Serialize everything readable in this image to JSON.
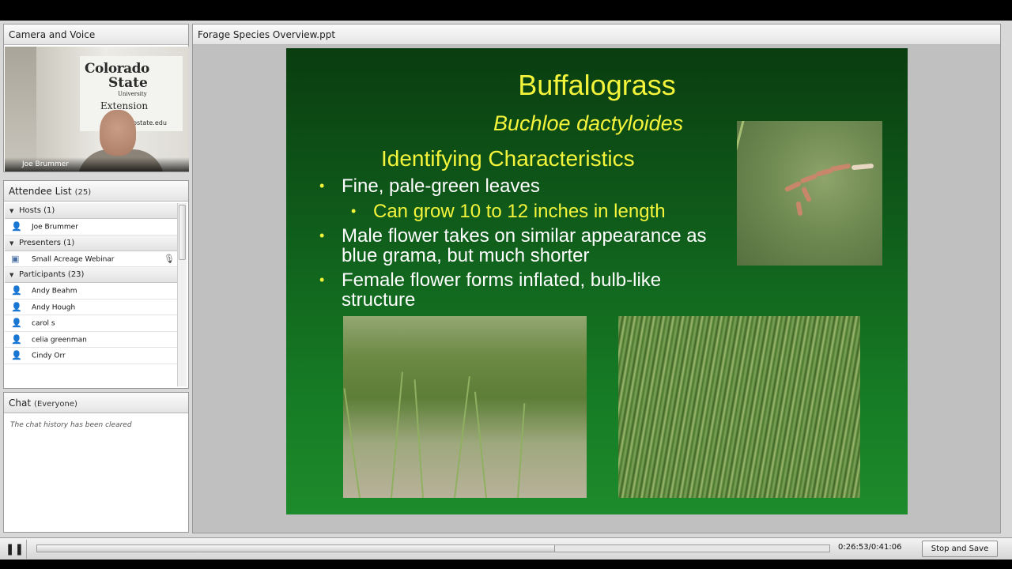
{
  "camera": {
    "title": "Camera and Voice",
    "presenter_name": "Joe Brummer",
    "sign": {
      "line1": "Colorado",
      "line2": "State",
      "line3": "University",
      "line4": "Extension",
      "line5": "olostate.edu"
    }
  },
  "attendees": {
    "title": "Attendee List",
    "count": "(25)",
    "groups": [
      {
        "label": "Hosts (1)",
        "members": [
          "Joe Brummer"
        ]
      },
      {
        "label": "Presenters (1)",
        "members": [
          "Small Acreage Webinar"
        ]
      },
      {
        "label": "Participants (23)",
        "members": [
          "Andy Beahm",
          "Andy Hough",
          "carol s",
          "celia greenman",
          "Cindy Orr"
        ]
      }
    ]
  },
  "chat": {
    "title": "Chat",
    "scope": "(Everyone)",
    "message": "The chat history has been cleared"
  },
  "share": {
    "title": "Forage Species Overview.ppt"
  },
  "slide": {
    "title": "Buffalograss",
    "latin": "Buchloe dactyloides",
    "heading": "Identifying Characteristics",
    "bullets": [
      "Fine, pale-green leaves",
      "Can grow 10 to 12 inches in length",
      "Male flower takes on similar appearance as blue grama, but much shorter",
      "Female flower forms inflated, bulb-like structure"
    ],
    "colors": {
      "accent": "#f4f43b",
      "text": "#ffffff",
      "bg": "#0f5a1a"
    }
  },
  "playback": {
    "time": "0:26:53/0:41:06",
    "progress_fraction": 0.654,
    "stop_label": "Stop and Save",
    "pause_icon": "pause-icon"
  }
}
